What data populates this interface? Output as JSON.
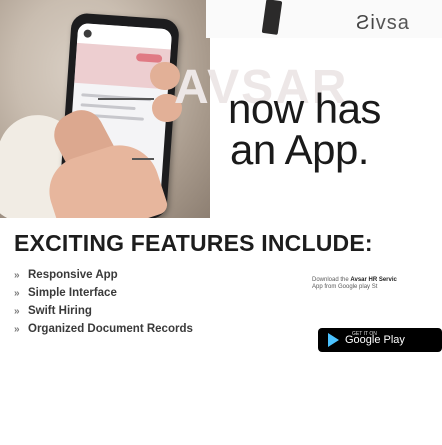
{
  "header": {
    "logo_text": "vsa",
    "logo_glyph": "Ƨi"
  },
  "hero": {
    "brand_watermark": "AVSAR",
    "tagline_line1": "now has",
    "tagline_line2": "an App."
  },
  "features": {
    "title": "EXCITING FEATURES INCLUDE:",
    "bullet_icon": "chevron-bullet-icon",
    "items": [
      {
        "label": "Responsive App"
      },
      {
        "label": "Simple Interface"
      },
      {
        "label": "Swift Hiring"
      },
      {
        "label": "Organized Document Records"
      }
    ]
  },
  "download": {
    "text_prefix": "Download the",
    "text_bold": "Avsar HR Servic",
    "text_suffix": "App from Google play St",
    "store_button": "Google Play",
    "store_button_small": "GET IT ON"
  },
  "colors": {
    "text_dark": "#1a1a1a",
    "watermark": "#ede7e7",
    "google_play_bg": "#000000"
  }
}
